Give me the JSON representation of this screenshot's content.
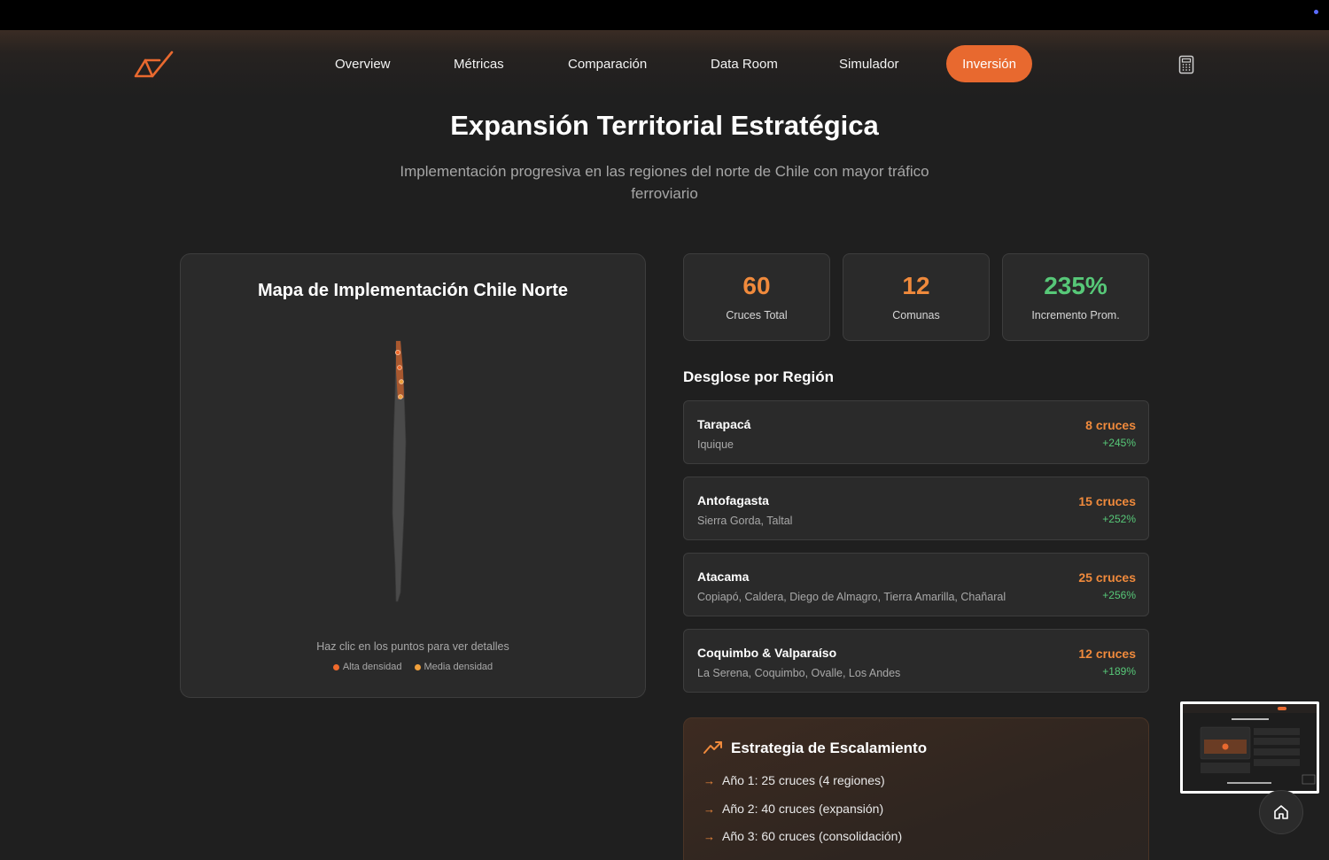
{
  "nav": {
    "items": [
      {
        "label": "Overview"
      },
      {
        "label": "Métricas"
      },
      {
        "label": "Comparación"
      },
      {
        "label": "Data Room"
      },
      {
        "label": "Simulador"
      }
    ],
    "active_label": "Inversión",
    "logo_icon": "logo-icon",
    "calculator_icon": "calculator-icon"
  },
  "header": {
    "title": "Expansión Territorial Estratégica",
    "subtitle": "Implementación progresiva en las regiones del norte de Chile con mayor tráfico ferroviario"
  },
  "map": {
    "title": "Mapa de Implementación Chile Norte",
    "hint": "Haz clic en los puntos para ver detalles",
    "legend": [
      {
        "label": "Alta densidad",
        "color": "#f06a2c"
      },
      {
        "label": "Media densidad",
        "color": "#f0a03c"
      }
    ]
  },
  "stats": [
    {
      "value": "60",
      "label": "Cruces Total",
      "color": "#f08a3c"
    },
    {
      "value": "12",
      "label": "Comunas",
      "color": "#f08a3c"
    },
    {
      "value": "235%",
      "label": "Incremento Prom.",
      "color": "#57c878"
    }
  ],
  "breakdown": {
    "title": "Desglose por Región",
    "regions": [
      {
        "name": "Tarapacá",
        "cities": "Iquique",
        "count": "8 cruces",
        "pct": "+245%"
      },
      {
        "name": "Antofagasta",
        "cities": "Sierra Gorda, Taltal",
        "count": "15 cruces",
        "pct": "+252%"
      },
      {
        "name": "Atacama",
        "cities": "Copiapó, Caldera, Diego de Almagro, Tierra Amarilla, Chañaral",
        "count": "25 cruces",
        "pct": "+256%"
      },
      {
        "name": "Coquimbo & Valparaíso",
        "cities": "La Serena, Coquimbo, Ovalle, Los Andes",
        "count": "12 cruces",
        "pct": "+189%"
      }
    ]
  },
  "strategy": {
    "title": "Estrategia de Escalamiento",
    "icon": "trending-up-icon",
    "items": [
      "Año 1: 25 cruces (4 regiones)",
      "Año 2: 40 cruces (expansión)",
      "Año 3: 60 cruces (consolidación)"
    ]
  },
  "colors": {
    "accent": "#e8692f",
    "positive": "#57c878",
    "background": "#1f1f1f"
  }
}
